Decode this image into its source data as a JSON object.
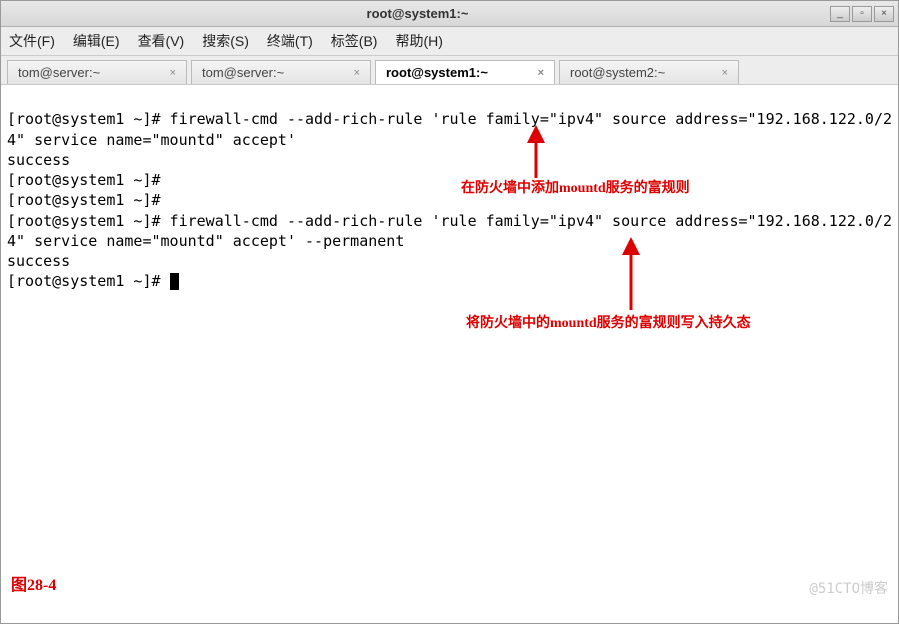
{
  "window": {
    "title": "root@system1:~"
  },
  "menu": {
    "file": "文件(F)",
    "edit": "编辑(E)",
    "view": "查看(V)",
    "search": "搜索(S)",
    "terminal": "终端(T)",
    "tabs": "标签(B)",
    "help": "帮助(H)"
  },
  "tabs": [
    {
      "label": "tom@server:~",
      "active": false
    },
    {
      "label": "tom@server:~",
      "active": false
    },
    {
      "label": "root@system1:~",
      "active": true
    },
    {
      "label": "root@system2:~",
      "active": false
    }
  ],
  "terminal_lines": [
    "[root@system1 ~]# firewall-cmd --add-rich-rule 'rule family=\"ipv4\" source address=\"192.168.122.0/24\" service name=\"mountd\" accept'",
    "success",
    "[root@system1 ~]#",
    "[root@system1 ~]#",
    "[root@system1 ~]# firewall-cmd --add-rich-rule 'rule family=\"ipv4\" source address=\"192.168.122.0/24\" service name=\"mountd\" accept' --permanent",
    "success",
    "[root@system1 ~]# "
  ],
  "annotations": {
    "a1": "在防火墙中添加mountd服务的富规则",
    "a2": "将防火墙中的mountd服务的富规则写入持久态"
  },
  "figure_label": "图28-4",
  "watermark": "@51CTO博客"
}
